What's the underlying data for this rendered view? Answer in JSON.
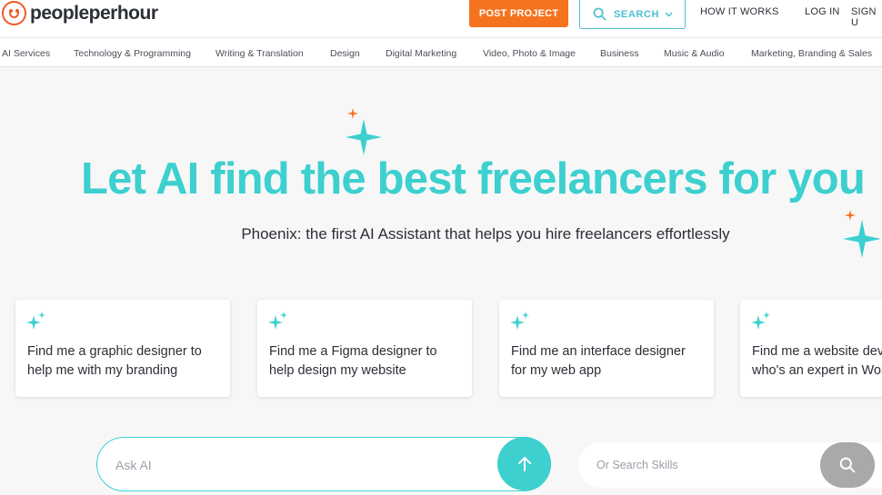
{
  "brand": {
    "name": "peopleperhour",
    "logo_color": "#ef5b2a"
  },
  "header": {
    "post_project": "POST PROJECT",
    "search": "SEARCH",
    "how_it_works": "HOW IT WORKS",
    "log_in": "LOG IN",
    "sign_up": "SIGN U"
  },
  "categories": [
    "AI Services",
    "Technology & Programming",
    "Writing & Translation",
    "Design",
    "Digital Marketing",
    "Video, Photo & Image",
    "Business",
    "Music & Audio",
    "Marketing, Branding & Sales"
  ],
  "hero": {
    "title": "Let AI find the best freelancers for you",
    "subtitle": "Phoenix: the first AI Assistant that helps you hire freelancers effortlessly"
  },
  "suggestions": [
    {
      "line1": "Find me a graphic designer to",
      "line2": "help me with my branding"
    },
    {
      "line1": "Find me a Figma designer to",
      "line2": "help design my website"
    },
    {
      "line1": "Find me an interface designer",
      "line2": "for my web app"
    },
    {
      "line1": "Find me a website developer",
      "line2": "who's an expert in WordPress"
    }
  ],
  "ask_ai": {
    "placeholder": "Ask AI"
  },
  "skills_search": {
    "placeholder": "Or Search Skills"
  },
  "icons": {
    "sparkle": "sparkle-icon",
    "search": "search-icon",
    "send": "arrow-up-icon"
  },
  "colors": {
    "accent": "#3dd0cf",
    "post_button": "#f5731e",
    "search_outline": "#4bbfd0",
    "sparkle_orange": "#f5731e"
  }
}
